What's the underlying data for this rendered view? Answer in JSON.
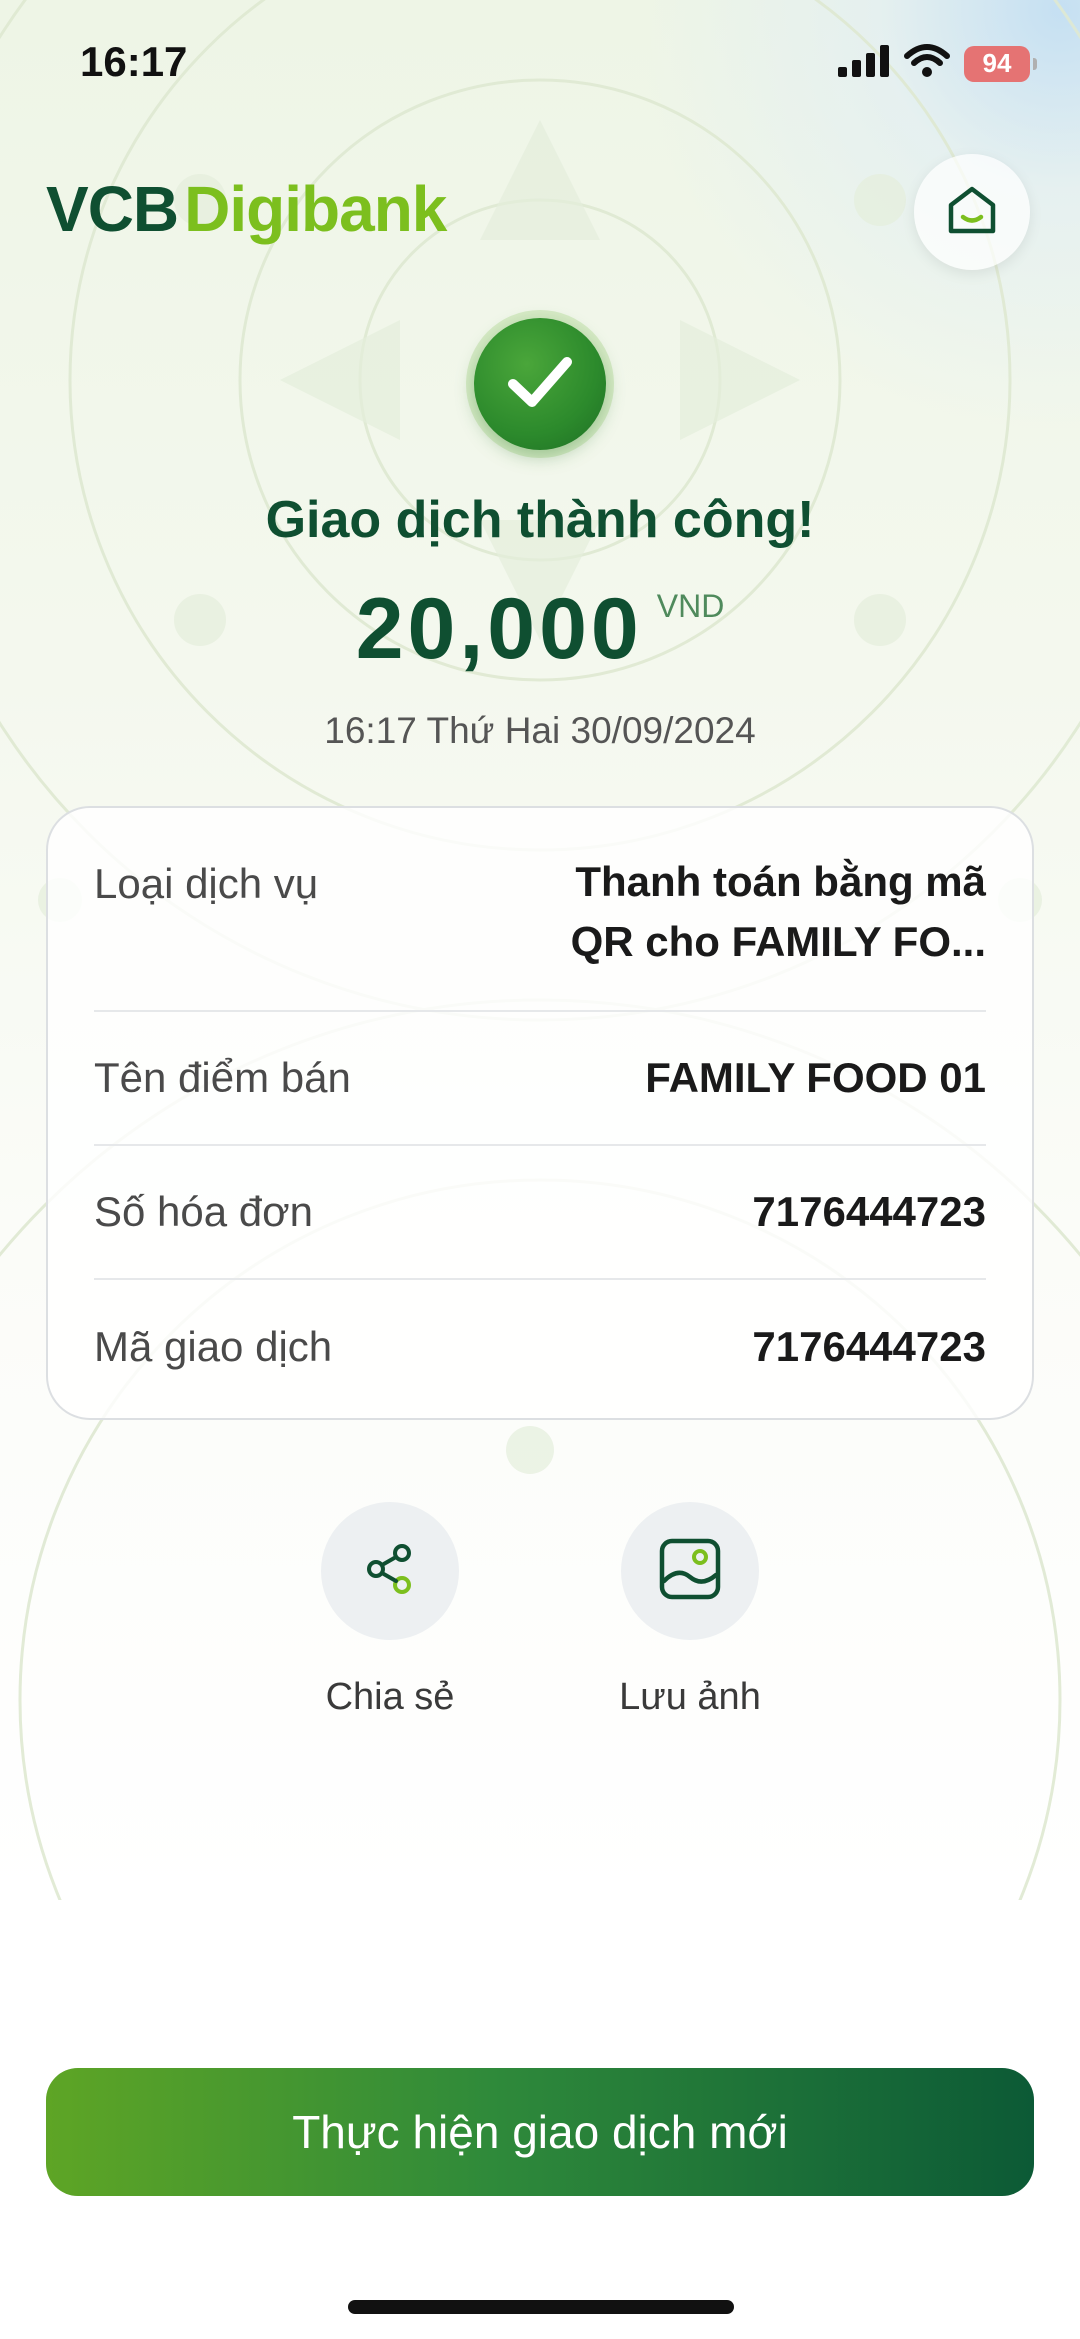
{
  "status_bar": {
    "time": "16:17",
    "battery": "94",
    "icons": [
      "signal-icon",
      "wifi-icon",
      "battery-icon"
    ]
  },
  "header": {
    "logo_part1": "VCB",
    "logo_part2": "Digibank",
    "home_icon": "home-icon"
  },
  "result": {
    "title": "Giao dịch thành công!",
    "amount": "20,000",
    "currency": "VND",
    "datetime": "16:17 Thứ Hai 30/09/2024",
    "icon": "check-icon"
  },
  "details": [
    {
      "label": "Loại dịch vụ",
      "value": "Thanh toán bằng mã QR cho FAMILY FO..."
    },
    {
      "label": "Tên điểm bán",
      "value": "FAMILY FOOD 01"
    },
    {
      "label": "Số hóa đơn",
      "value": "7176444723"
    },
    {
      "label": "Mã giao dịch",
      "value": "7176444723"
    }
  ],
  "actions": {
    "share": {
      "label": "Chia sẻ",
      "icon": "share-icon"
    },
    "save_image": {
      "label": "Lưu ảnh",
      "icon": "image-icon"
    }
  },
  "primary_button": {
    "label": "Thực hiện giao dịch mới"
  },
  "colors": {
    "brand_dark_green": "#0f4f31",
    "brand_light_green": "#7cbf1e",
    "success_green": "#2c8a2c"
  }
}
